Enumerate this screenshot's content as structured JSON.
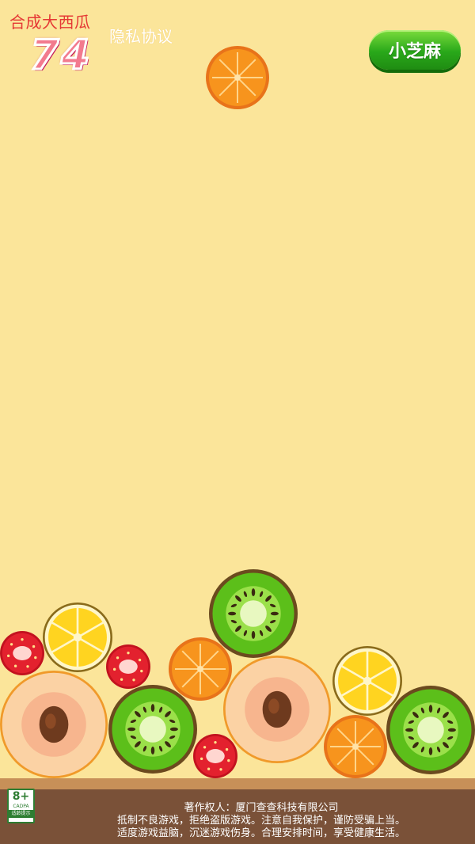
{
  "hud": {
    "title": "合成大西瓜",
    "score": "74",
    "privacy_link": "隐私协议"
  },
  "button": {
    "label": "小芝麻"
  },
  "footer": {
    "copyright": "著作权人：厦门查查科技有限公司",
    "line1": "抵制不良游戏，拒绝盗版游戏。注意自我保护，谨防受骗上当。",
    "line2": "适度游戏益脑，沉迷游戏伤身。合理安排时间，享受健康生活。",
    "age_rating": "8+",
    "age_rating_sub": "CADPA",
    "age_rating_label": "适龄提示"
  },
  "fruits": {
    "next": "orange",
    "on_board": [
      "strawberry",
      "lemon",
      "kiwi",
      "strawberry",
      "orange",
      "lemon",
      "peach",
      "kiwi",
      "peach",
      "strawberry",
      "orange",
      "kiwi"
    ]
  }
}
